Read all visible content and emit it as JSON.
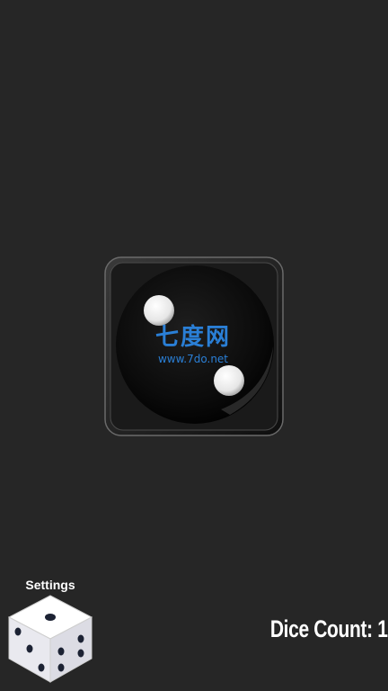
{
  "app": {
    "background_color": "#262626"
  },
  "die": {
    "face_value": 2,
    "color": "#0a0a0a",
    "pip_color": "#ffffff"
  },
  "watermark": {
    "logo": "七度网",
    "url": "www.7do.net",
    "color": "#2a7fd6"
  },
  "settings": {
    "label": "Settings",
    "icon": "dice-icon"
  },
  "status": {
    "dice_count_label": "Dice Count: 1"
  }
}
